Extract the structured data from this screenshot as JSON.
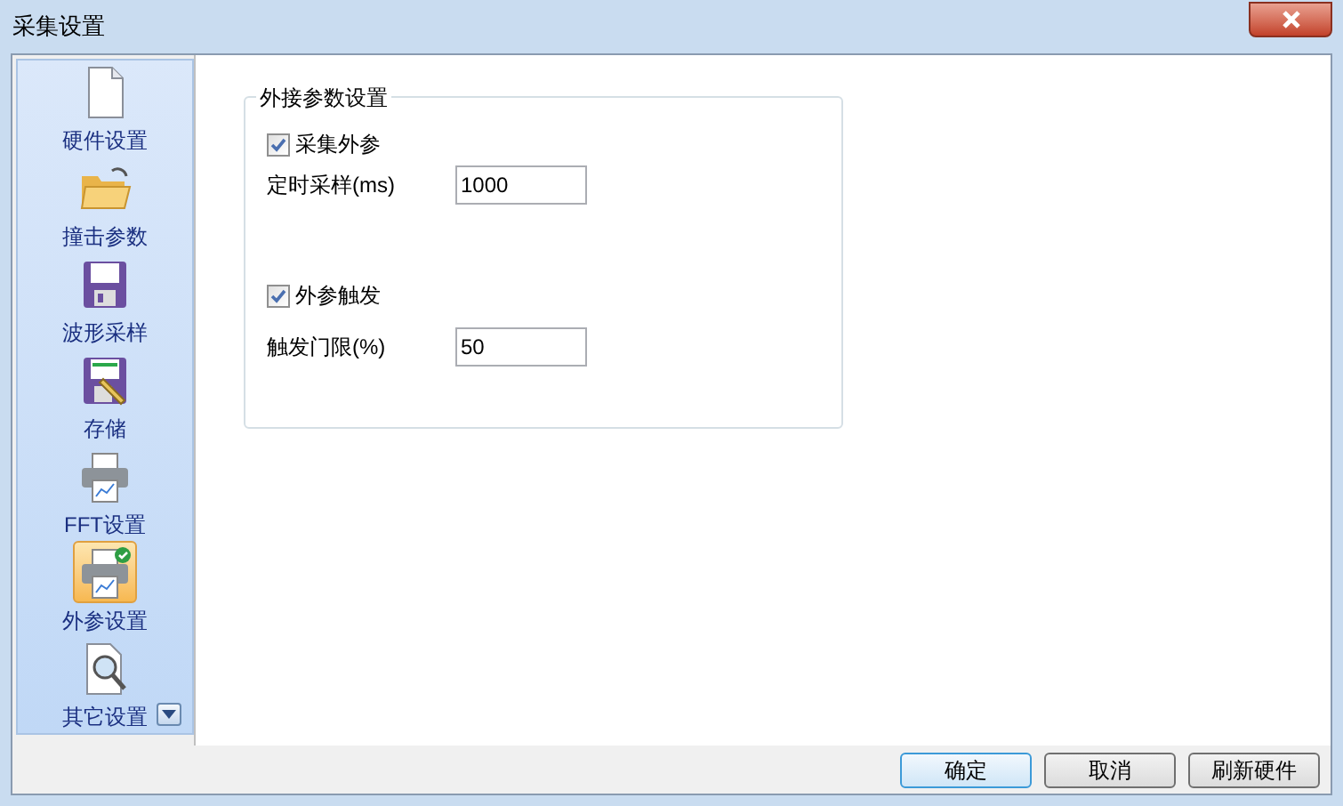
{
  "window": {
    "title": "采集设置"
  },
  "sidebar": {
    "items": [
      {
        "label": "硬件设置",
        "kind": "document",
        "selected": false
      },
      {
        "label": "撞击参数",
        "kind": "folder",
        "selected": false
      },
      {
        "label": "波形采样",
        "kind": "floppy",
        "selected": false
      },
      {
        "label": "存储",
        "kind": "floppy-pencil",
        "selected": false
      },
      {
        "label": "FFT设置",
        "kind": "printer",
        "selected": false
      },
      {
        "label": "外参设置",
        "kind": "printer-check",
        "selected": true
      },
      {
        "label": "其它设置",
        "kind": "magnifier",
        "selected": false
      }
    ]
  },
  "group": {
    "title": "外接参数设置",
    "sections": [
      {
        "checkbox": {
          "label": "采集外参",
          "checked": true
        },
        "field": {
          "label": "定时采样(ms)",
          "value": "1000"
        }
      },
      {
        "checkbox": {
          "label": "外参触发",
          "checked": true
        },
        "field": {
          "label": "触发门限(%)",
          "value": "50"
        }
      }
    ]
  },
  "buttons": [
    {
      "label": "确定",
      "default": true
    },
    {
      "label": "取消",
      "default": false
    },
    {
      "label": "刷新硬件",
      "default": false
    }
  ]
}
